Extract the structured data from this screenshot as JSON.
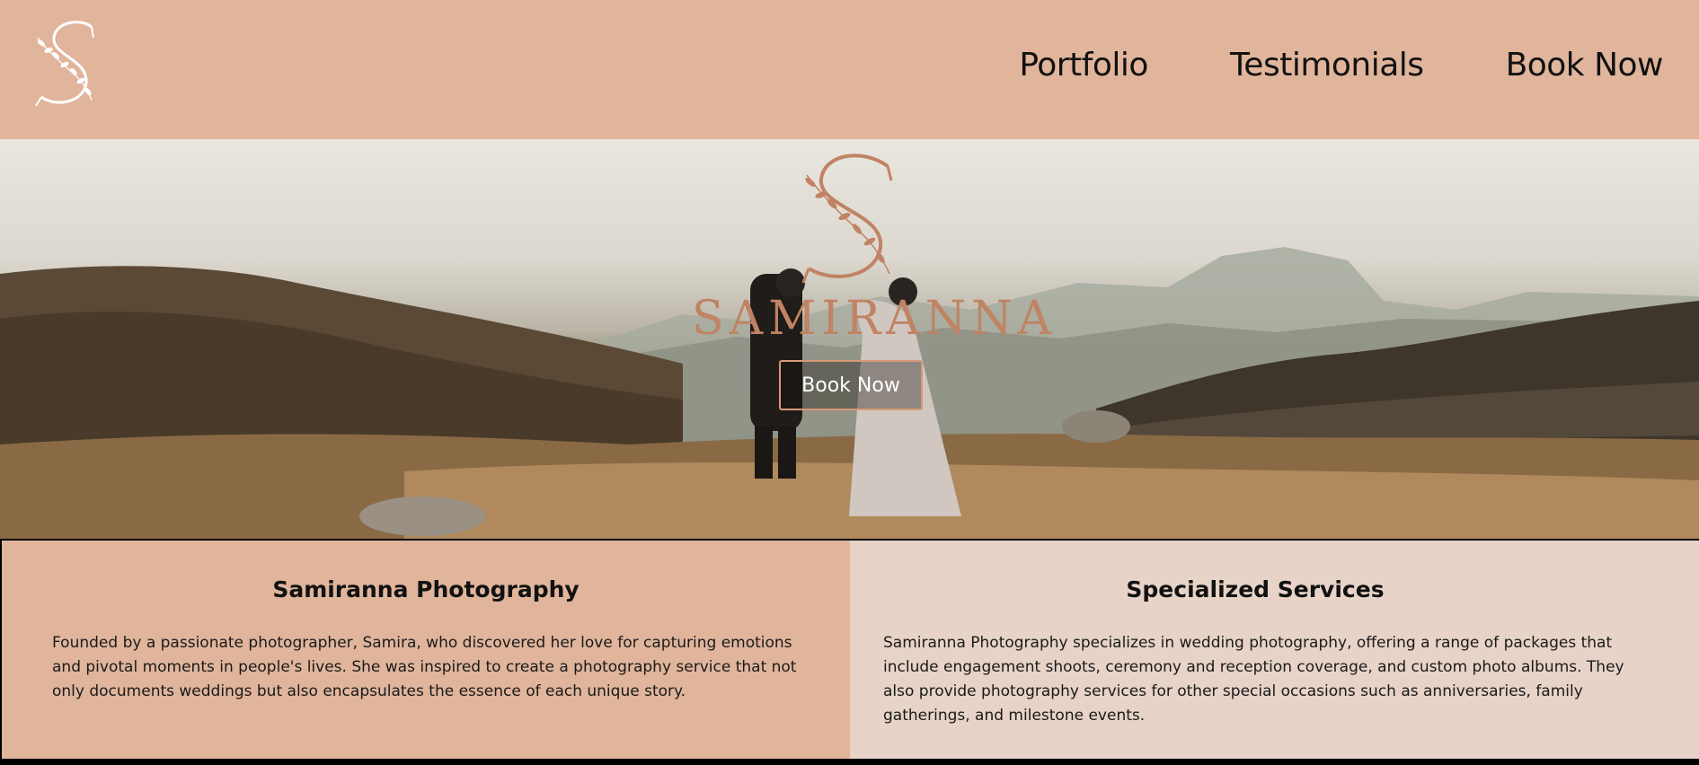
{
  "header": {
    "logo_icon": "script-s-leaf-monogram-icon",
    "nav": [
      {
        "label": "Portfolio"
      },
      {
        "label": "Testimonials"
      },
      {
        "label": "Book Now"
      }
    ]
  },
  "hero": {
    "brand": "SAMIRANNA",
    "cta_label": "Book Now",
    "image": "couple-walking-on-hillside-photo"
  },
  "about": {
    "title": "Samiranna Photography",
    "body": "Founded by a passionate photographer, Samira, who discovered her love for capturing emotions and pivotal moments in people's lives. She was inspired to create a photography service that not only documents weddings but also encapsulates the essence of each unique story."
  },
  "services": {
    "title": "Specialized Services",
    "body": "Samiranna Photography specializes in wedding photography, offering a range of packages that include engagement shoots, ceremony and reception coverage, and custom photo albums. They also provide photography services for other special occasions such as anniversaries, family gatherings, and milestone events."
  },
  "colors": {
    "brand_peach": "#e0b59b",
    "light_blush": "#e7d3c7",
    "logo_copper": "#c08363"
  }
}
